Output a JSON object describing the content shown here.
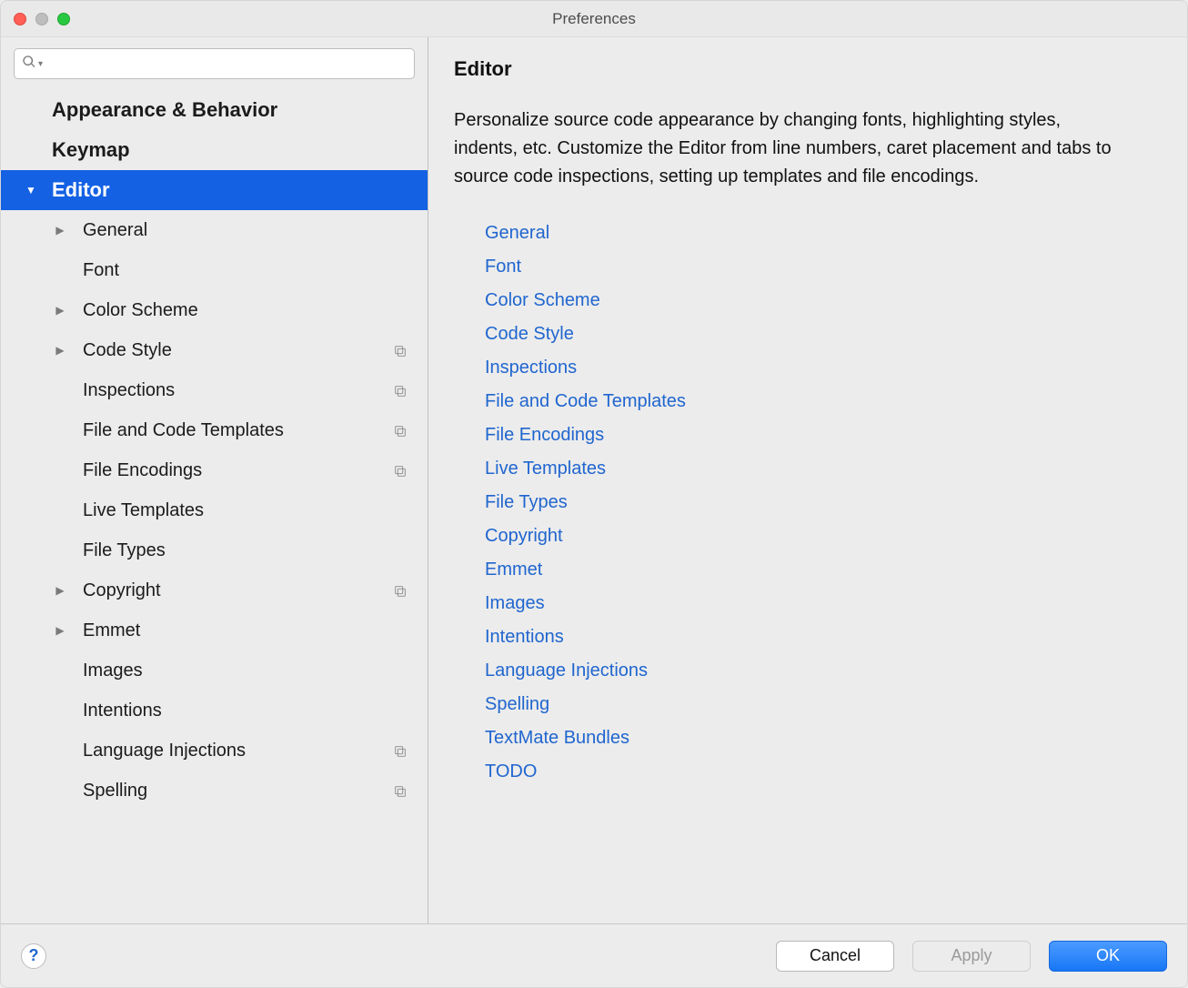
{
  "window": {
    "title": "Preferences"
  },
  "search": {
    "value": "",
    "placeholder": ""
  },
  "sidebar": {
    "items": [
      {
        "label": "Appearance & Behavior",
        "level": "top",
        "arrow": "",
        "selected": false,
        "copy": false
      },
      {
        "label": "Keymap",
        "level": "top",
        "arrow": "",
        "selected": false,
        "copy": false
      },
      {
        "label": "Editor",
        "level": "top",
        "arrow": "▼",
        "selected": true,
        "copy": false
      },
      {
        "label": "General",
        "level": "sub",
        "arrow": "▶",
        "selected": false,
        "copy": false
      },
      {
        "label": "Font",
        "level": "sub",
        "arrow": "",
        "selected": false,
        "copy": false
      },
      {
        "label": "Color Scheme",
        "level": "sub",
        "arrow": "▶",
        "selected": false,
        "copy": false
      },
      {
        "label": "Code Style",
        "level": "sub",
        "arrow": "▶",
        "selected": false,
        "copy": true
      },
      {
        "label": "Inspections",
        "level": "sub",
        "arrow": "",
        "selected": false,
        "copy": true
      },
      {
        "label": "File and Code Templates",
        "level": "sub",
        "arrow": "",
        "selected": false,
        "copy": true
      },
      {
        "label": "File Encodings",
        "level": "sub",
        "arrow": "",
        "selected": false,
        "copy": true
      },
      {
        "label": "Live Templates",
        "level": "sub",
        "arrow": "",
        "selected": false,
        "copy": false
      },
      {
        "label": "File Types",
        "level": "sub",
        "arrow": "",
        "selected": false,
        "copy": false
      },
      {
        "label": "Copyright",
        "level": "sub",
        "arrow": "▶",
        "selected": false,
        "copy": true
      },
      {
        "label": "Emmet",
        "level": "sub",
        "arrow": "▶",
        "selected": false,
        "copy": false
      },
      {
        "label": "Images",
        "level": "sub",
        "arrow": "",
        "selected": false,
        "copy": false
      },
      {
        "label": "Intentions",
        "level": "sub",
        "arrow": "",
        "selected": false,
        "copy": false
      },
      {
        "label": "Language Injections",
        "level": "sub",
        "arrow": "",
        "selected": false,
        "copy": true
      },
      {
        "label": "Spelling",
        "level": "sub",
        "arrow": "",
        "selected": false,
        "copy": true
      }
    ]
  },
  "main": {
    "heading": "Editor",
    "description": "Personalize source code appearance by changing fonts, highlighting styles, indents, etc. Customize the Editor from line numbers, caret placement and tabs to source code inspections, setting up templates and file encodings.",
    "links": [
      "General",
      "Font",
      "Color Scheme",
      "Code Style",
      "Inspections",
      "File and Code Templates",
      "File Encodings",
      "Live Templates",
      "File Types",
      "Copyright",
      "Emmet",
      "Images",
      "Intentions",
      "Language Injections",
      "Spelling",
      "TextMate Bundles",
      "TODO"
    ]
  },
  "footer": {
    "help": "?",
    "cancel": "Cancel",
    "apply": "Apply",
    "ok": "OK"
  }
}
